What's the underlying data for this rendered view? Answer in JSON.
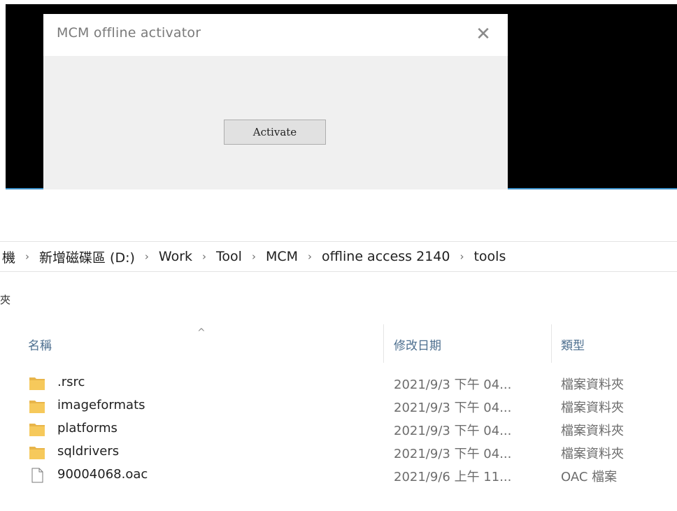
{
  "dialog": {
    "title": "MCM offline activator",
    "close_glyph": "✕",
    "activate_label": "Activate"
  },
  "explorer": {
    "breadcrumb": [
      "機",
      "新增磁碟區 (D:)",
      "Work",
      "Tool",
      "MCM",
      "offline access 2140",
      "tools"
    ],
    "breadcrumb_separator": "›",
    "folder_bar_text": "夾",
    "columns": {
      "name": "名稱",
      "date": "修改日期",
      "type": "類型"
    },
    "sort_indicator": "^",
    "files": [
      {
        "name": ".rsrc",
        "date": "2021/9/3 下午 04...",
        "type": "檔案資料夾",
        "icon": "folder-icon"
      },
      {
        "name": "imageformats",
        "date": "2021/9/3 下午 04...",
        "type": "檔案資料夾",
        "icon": "folder-icon"
      },
      {
        "name": "platforms",
        "date": "2021/9/3 下午 04...",
        "type": "檔案資料夾",
        "icon": "folder-icon"
      },
      {
        "name": "sqldrivers",
        "date": "2021/9/3 下午 04...",
        "type": "檔案資料夾",
        "icon": "folder-icon"
      },
      {
        "name": "90004068.oac",
        "date": "2021/9/6 上午 11...",
        "type": "OAC 檔案",
        "icon": "file-icon"
      }
    ]
  },
  "colors": {
    "folder_yellow": "#f6c95b",
    "accent_blue": "#3b8fc8",
    "header_text": "#4d6f8f"
  }
}
